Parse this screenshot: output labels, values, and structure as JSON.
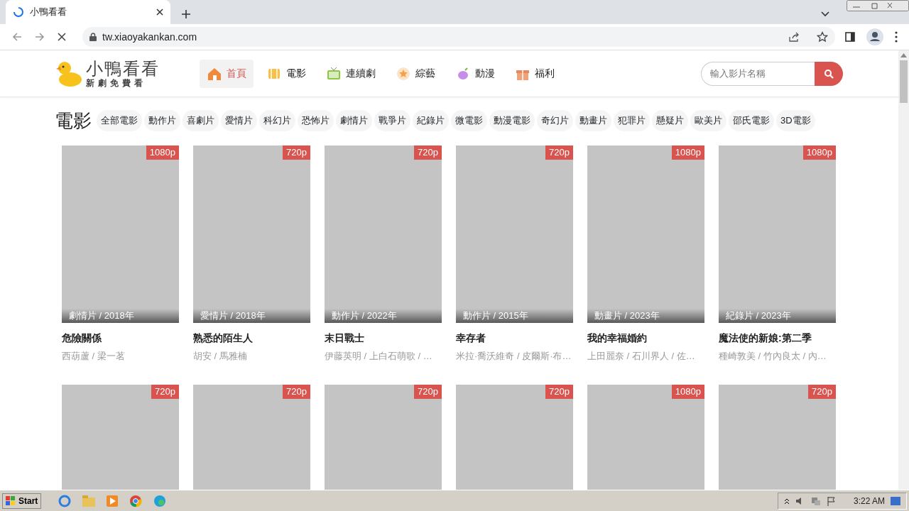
{
  "browser": {
    "tab_title": "小鴨看看",
    "url": "tw.xiaoyakankan.com"
  },
  "site": {
    "logo_title": "小鴨看看",
    "logo_subtitle": "新劇免費看",
    "nav": [
      {
        "label": "首頁",
        "selected": true
      },
      {
        "label": "電影",
        "selected": false
      },
      {
        "label": "連續劇",
        "selected": false
      },
      {
        "label": "綜藝",
        "selected": false
      },
      {
        "label": "動漫",
        "selected": false
      },
      {
        "label": "福利",
        "selected": false
      }
    ],
    "search": {
      "placeholder": "輸入影片名稱"
    }
  },
  "category": {
    "title": "電影",
    "filters": [
      "全部電影",
      "動作片",
      "喜劇片",
      "愛情片",
      "科幻片",
      "恐怖片",
      "劇情片",
      "戰爭片",
      "紀錄片",
      "微電影",
      "動漫電影",
      "奇幻片",
      "動畫片",
      "犯罪片",
      "懸疑片",
      "歐美片",
      "邵氏電影",
      "3D電影"
    ]
  },
  "movies": [
    {
      "quality": "1080p",
      "genre_year": "劇情片 / 2018年",
      "title": "危險關係",
      "cast": "西葫蘆 / 梁一茗"
    },
    {
      "quality": "720p",
      "genre_year": "愛情片 / 2018年",
      "title": "熟悉的陌生人",
      "cast": "胡安 / 馬雅楠"
    },
    {
      "quality": "720p",
      "genre_year": "動作片 / 2022年",
      "title": "末日戰士",
      "cast": "伊藤英明 / 上白石萌歌 / …"
    },
    {
      "quality": "720p",
      "genre_year": "動作片 / 2015年",
      "title": "幸存者",
      "cast": "米拉·喬沃維奇 / 皮爾斯·布…"
    },
    {
      "quality": "1080p",
      "genre_year": "動畫片 / 2023年",
      "title": "我的幸福婚約",
      "cast": "上田麗奈 / 石川界人 / 佐…"
    },
    {
      "quality": "1080p",
      "genre_year": "紀錄片 / 2023年",
      "title": "魔法使的新娘:第二季",
      "cast": "種崎敦美 / 竹內良太 / 內…"
    },
    {
      "quality": "720p"
    },
    {
      "quality": "720p"
    },
    {
      "quality": "720p"
    },
    {
      "quality": "720p"
    },
    {
      "quality": "1080p"
    },
    {
      "quality": "720p"
    }
  ],
  "taskbar": {
    "start": "Start",
    "clock": "3:22 AM"
  }
}
